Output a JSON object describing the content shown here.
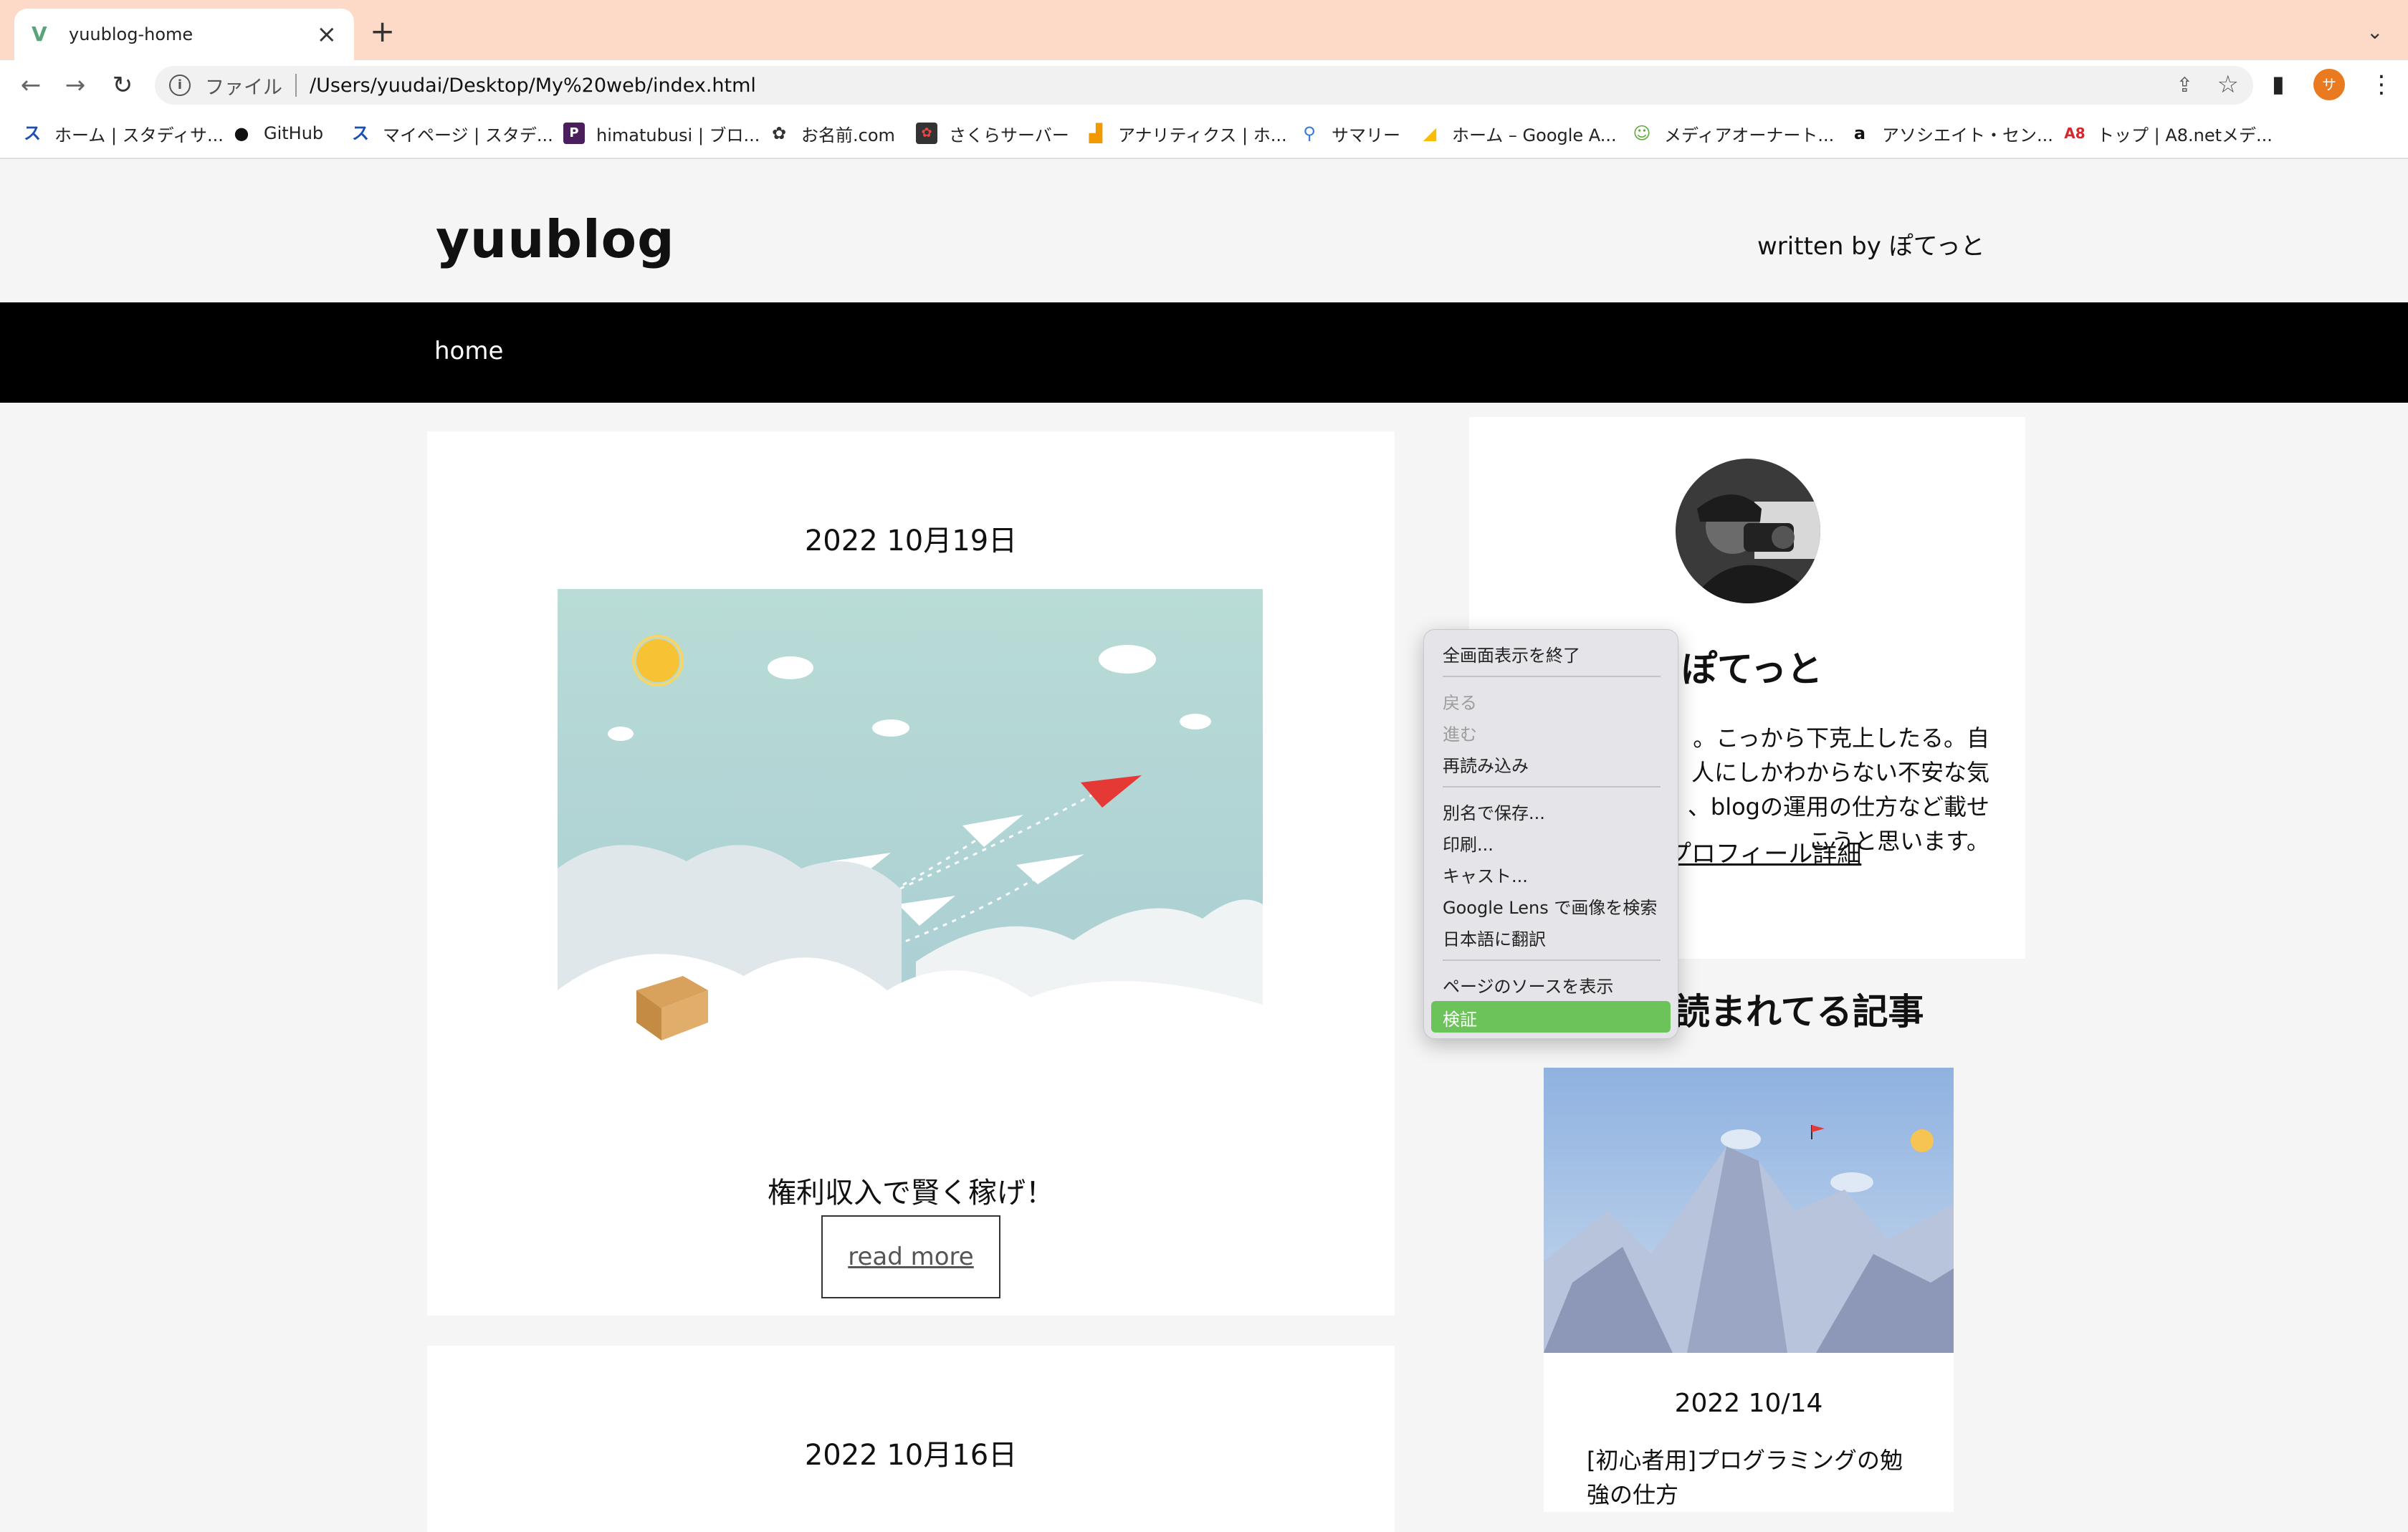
{
  "browser": {
    "tab_title": "yuublog-home",
    "tab_favicon": "vue-icon",
    "new_tab": "+",
    "address_scheme": "ファイル",
    "address_url": "/Users/yuudai/Desktop/My%20web/index.html",
    "profile_initial": "サ",
    "theme_color": "#fdd9c7"
  },
  "bookmarks": [
    {
      "label": "ホーム | スタディサ...",
      "icon": "studysapuri-icon"
    },
    {
      "label": "GitHub",
      "icon": "github-icon"
    },
    {
      "label": "マイページ | スタデ...",
      "icon": "studysapuri-icon"
    },
    {
      "label": "himatubusi | ブロ...",
      "icon": "blog-icon"
    },
    {
      "label": "お名前.com",
      "icon": "onamae-icon"
    },
    {
      "label": "さくらサーバー",
      "icon": "sakura-icon"
    },
    {
      "label": "アナリティクス | ホ...",
      "icon": "analytics-icon"
    },
    {
      "label": "サマリー",
      "icon": "summary-icon"
    },
    {
      "label": "ホーム – Google A...",
      "icon": "google-ads-icon"
    },
    {
      "label": "メディアオーナート...",
      "icon": "media-icon"
    },
    {
      "label": "アソシエイト・セン...",
      "icon": "amazon-icon"
    },
    {
      "label": "トップ | A8.netメデ...",
      "icon": "a8-icon"
    }
  ],
  "site": {
    "title": "yuublog",
    "author": "written by ぽてっと",
    "nav_home": "home"
  },
  "posts": [
    {
      "date": "2022 10月19日",
      "title": "権利収入で賢く稼げ！",
      "read_more": "read more"
    },
    {
      "date": "2022 10月16日"
    }
  ],
  "sidebar": {
    "name": "ぽてっと",
    "desc_lines": [
      "。こっから下克上したる。自",
      "人にしかわからない不安な気",
      "、blogの運用の仕方など載せ",
      "こうと思います。"
    ],
    "profile_link": "プロフィール詳細",
    "popular_heading": "読まれてる記事",
    "popular": {
      "date": "2022 10/14",
      "title": "[初心者用]プログラミングの勉強の仕方"
    }
  },
  "context_menu": {
    "items": [
      {
        "label": "全画面表示を終了",
        "disabled": false
      },
      {
        "label": "戻る",
        "disabled": true
      },
      {
        "label": "進む",
        "disabled": true
      },
      {
        "label": "再読み込み",
        "disabled": false
      },
      {
        "label": "別名で保存...",
        "disabled": false
      },
      {
        "label": "印刷...",
        "disabled": false
      },
      {
        "label": "キャスト...",
        "disabled": false
      },
      {
        "label": "Google Lens で画像を検索",
        "disabled": false
      },
      {
        "label": "日本語に翻訳",
        "disabled": false
      },
      {
        "label": "ページのソースを表示",
        "disabled": false
      },
      {
        "label": "検証",
        "disabled": false,
        "selected": true
      }
    ],
    "highlight_color": "#6cc35a"
  }
}
